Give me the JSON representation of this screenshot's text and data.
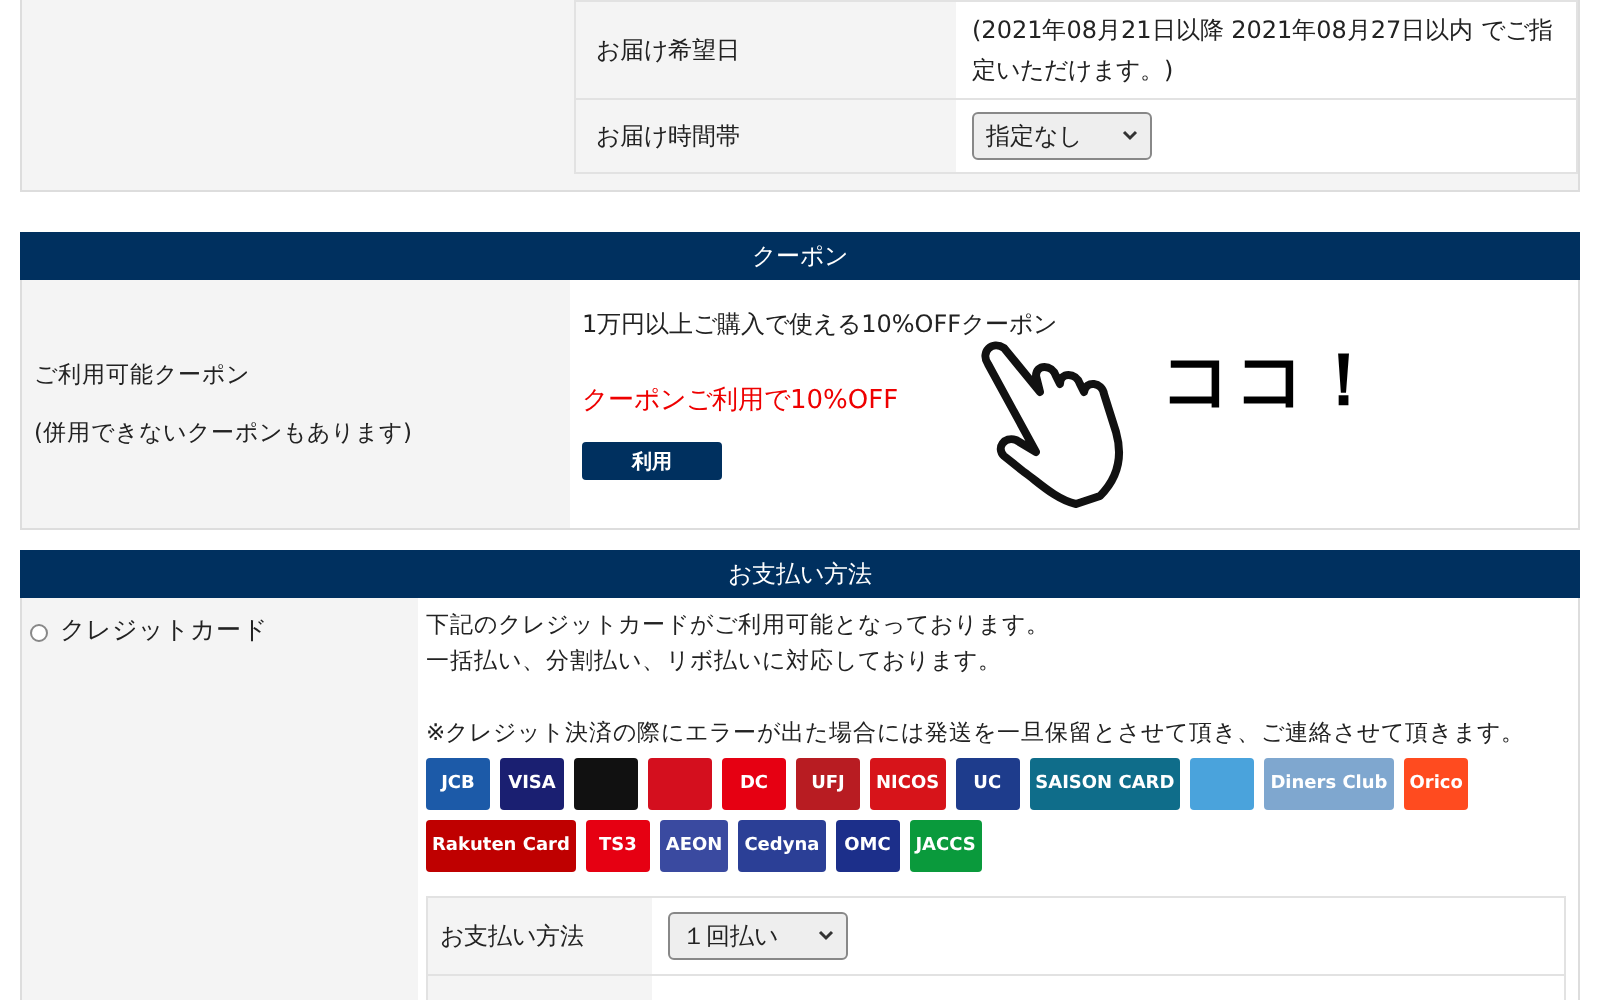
{
  "delivery": {
    "rows": [
      {
        "label": "お届け希望日",
        "kind": "text",
        "value": "(2021年08月21日以降 2021年08月27日以内 でご指定いただけます。)"
      },
      {
        "label": "お届け時間帯",
        "kind": "select",
        "value": "指定なし"
      }
    ]
  },
  "coupon": {
    "title": "クーポン",
    "label": "ご利用可能クーポン",
    "note": "(併用できないクーポンもあります)",
    "description": "1万円以上ご購入で使える10%OFFクーポン",
    "highlight": "クーポンご利用で10%OFF",
    "button": "利用",
    "callout": "ココ！"
  },
  "payment": {
    "title": "お支払い方法",
    "method": {
      "label": "クレジットカード",
      "selected": false
    },
    "lines": [
      "下記のクレジットカードがご利用可能となっております。",
      "一括払い、分割払い、リボ払いに対応しております。"
    ],
    "notice": "※クレジット決済の際にエラーが出た場合には発送を一旦保留とさせて頂き、ご連絡させて頂きます。",
    "cards": [
      {
        "label": "JCB",
        "color": "#1c5aa8"
      },
      {
        "label": "VISA",
        "color": "#1a1f71"
      },
      {
        "color": "#111111"
      },
      {
        "color": "#d40f1e"
      },
      {
        "label": "DC",
        "color": "#e60012"
      },
      {
        "label": "UFJ",
        "color": "#b81c22"
      },
      {
        "label": "NICOS",
        "color": "#d7141a"
      },
      {
        "label": "UC",
        "color": "#1e3c8c"
      },
      {
        "label": "SAISON CARD",
        "color": "#0f6d8a"
      },
      {
        "color": "#4aa3dc"
      },
      {
        "label": "Diners Club",
        "color": "#7fa7cf"
      },
      {
        "label": "Orico",
        "color": "#ff4b1f"
      },
      {
        "label": "Rakuten Card",
        "color": "#bf0000"
      },
      {
        "label": "TS3",
        "color": "#e60012"
      },
      {
        "label": "AEON",
        "color": "#3a4aa0"
      },
      {
        "label": "Cedyna",
        "color": "#2b3f96"
      },
      {
        "label": "OMC",
        "color": "#1c2f8a"
      },
      {
        "label": "JACCS",
        "color": "#0a9a3c"
      }
    ],
    "rows": [
      {
        "label": "お支払い方法",
        "value": "１回払い"
      }
    ]
  }
}
